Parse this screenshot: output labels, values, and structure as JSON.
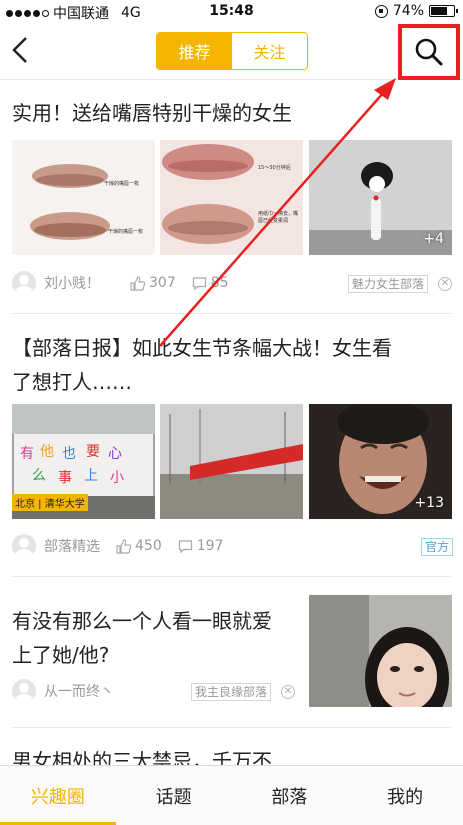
{
  "status_bar": {
    "carrier": "中国联通",
    "network": "4G",
    "time": "15:48",
    "battery": "74%",
    "battery_level": 0.74
  },
  "header": {
    "segments": [
      "推荐",
      "关注"
    ],
    "active_segment": 0
  },
  "posts": [
    {
      "title": "实用！送给嘴唇特别干燥的女生",
      "author": "刘小贱！",
      "likes": "307",
      "comments": "85",
      "tag": "魅力女生部落",
      "image_count": "+4",
      "image_captions": [
        "干燥的嘴唇一枚",
        "干燥的嘴唇一枚",
        "15～30分钟后",
        "用纸巾一擦去，嘴唇已经变柔润"
      ]
    },
    {
      "title_lines": [
        "【部落日报】如此女生节条幅大战！女生看",
        "了想打人……"
      ],
      "author": "部落精选",
      "likes": "450",
      "comments": "197",
      "tag": "官方",
      "image_count": "+13",
      "banner_text": "北京 | 清华大学"
    },
    {
      "title_lines": [
        "有没有那么一个人看一眼就爱",
        "上了她/他?"
      ],
      "author": "从一而终丶",
      "tag": "我主良缘部落"
    },
    {
      "title": "男女相处的三大禁忌，千万不"
    }
  ],
  "tabs": [
    "兴趣圈",
    "话题",
    "部落",
    "我的"
  ],
  "active_tab": 0,
  "colors": {
    "accent": "#f5b400",
    "highlight": "#e82020",
    "meta_text": "#999999"
  }
}
